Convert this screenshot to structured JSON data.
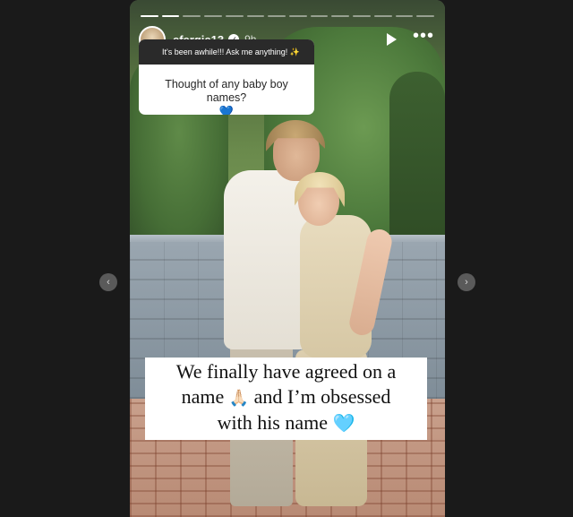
{
  "story": {
    "progress_segments": 14,
    "progress_current": 2,
    "header": {
      "username": "efergie13",
      "verified_icon": "verified-badge-icon",
      "time_ago": "9h",
      "play_icon": "play-icon",
      "more_icon": "more-options-icon",
      "more_glyph": "•••"
    },
    "question_sticker": {
      "prompt": "It's been awhile!!! Ask me anything! ✨",
      "question": "Thought of any baby boy names?",
      "heart": "💙"
    },
    "caption": {
      "line1": "We finally have agreed on a",
      "line2_pre": "name",
      "line2_emoji": "🙏🏻",
      "line2_post": "and I’m obsessed",
      "line3": "with his name",
      "line3_emoji": "🩵"
    }
  },
  "navigation": {
    "prev_glyph": "‹",
    "next_glyph": "›"
  },
  "colors": {
    "page_background": "#1a1a1a",
    "heart_blue": "#3d7ed8",
    "sticker_header": "#2a2a2a"
  }
}
